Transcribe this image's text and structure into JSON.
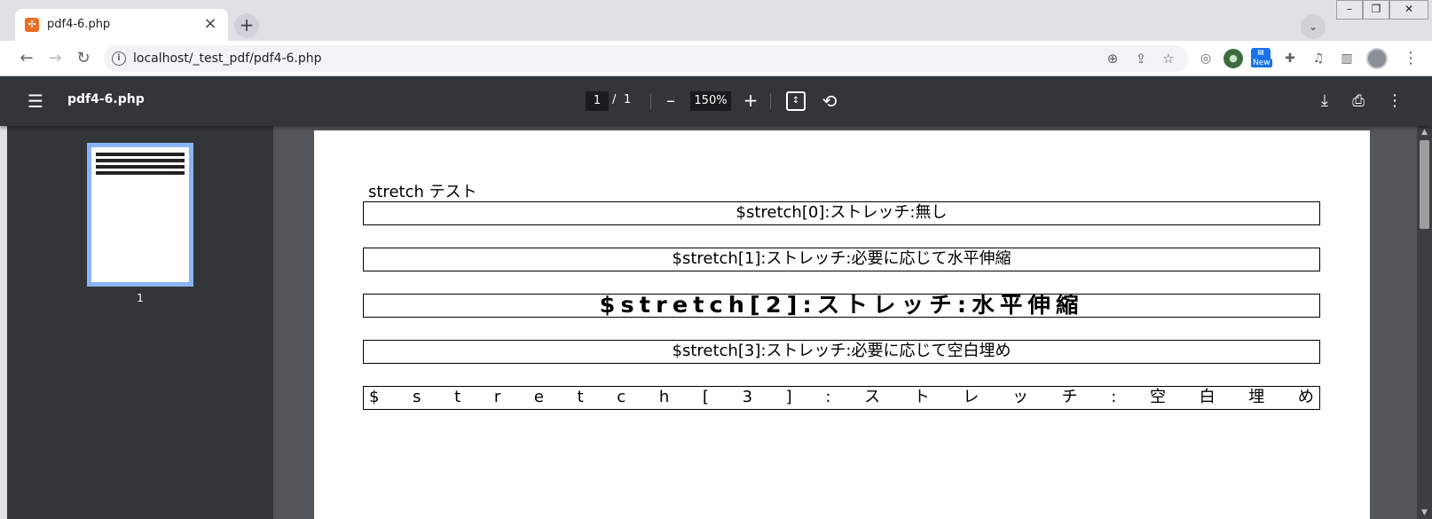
{
  "tab": {
    "title": "pdf4-6.php",
    "favicon": "xampp-icon",
    "close": "×"
  },
  "new_tab": "+",
  "tab_search": "⌄",
  "window_controls": {
    "minimize": "–",
    "maximize": "❐",
    "close": "✕"
  },
  "nav": {
    "back": "←",
    "forward": "→",
    "reload": "↻"
  },
  "omnibox": {
    "url": "localhost/_test_pdf/pdf4-6.php",
    "info": "i"
  },
  "extensions": {
    "new_badge": "New"
  },
  "pdf_toolbar": {
    "title": "pdf4-6.php",
    "current_page": "1",
    "separator": "/",
    "total_pages": "1",
    "zoom": "150%",
    "zoom_out": "–",
    "zoom_in": "+"
  },
  "sidebar": {
    "thumb_label": "1"
  },
  "document": {
    "heading": "stretch テスト",
    "row0": "$stretch[0]:ストレッチ:無し",
    "row1": "$stretch[1]:ストレッチ:必要に応じて水平伸縮",
    "row2": "$stretch[2]:ストレッチ:水平伸縮",
    "row3": "$stretch[3]:ストレッチ:必要に応じて空白埋め",
    "row4": "$stretch[3]:ストレッチ:空白埋め"
  },
  "colors": {
    "chrome_bg": "#dee1e6",
    "pdf_toolbar_bg": "#323639",
    "pdf_area_bg": "#525659",
    "thumb_border": "#8ab4f8",
    "favicon": "#ef6c23"
  }
}
